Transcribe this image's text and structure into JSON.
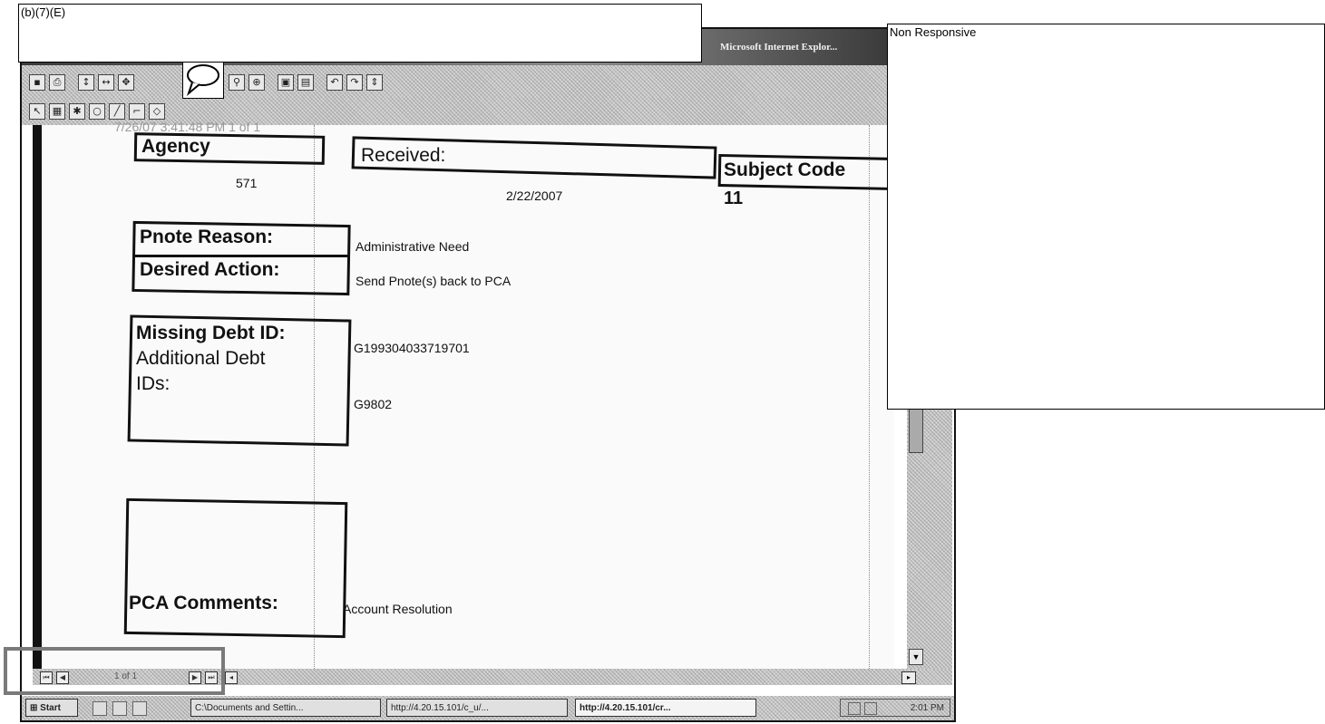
{
  "redactions": {
    "top_left": "(b)(7)(E)",
    "top_right": "Non Responsive"
  },
  "browser": {
    "title": "Microsoft Internet Explor..."
  },
  "document": {
    "faint_header": "7/26/07 3:41:48 PM  1 of 1",
    "agency_label": "Agency",
    "agency_value": "571",
    "received_label": "Received:",
    "received_value": "2/22/2007",
    "subject_code_label": "Subject Code",
    "subject_code_value": "11",
    "pnote_reason_label": "Pnote Reason:",
    "pnote_reason_value": "Administrative Need",
    "desired_action_label": "Desired Action:",
    "desired_action_value": "Send Pnote(s) back to PCA",
    "missing_debt_label": "Missing Debt ID:",
    "missing_debt_value": "G199304033719701",
    "additional_debt_label_1": "Additional Debt",
    "additional_debt_label_2": "IDs:",
    "additional_debt_value": "G9802",
    "pca_comments_label": "PCA Comments:",
    "pca_comments_value": "Account Resolution"
  },
  "viewer": {
    "page_indicator": "1 of 1"
  },
  "taskbar": {
    "start_label": "Start",
    "items": [
      "C:\\Documents and Settin...",
      "http://4.20.15.101/c_u/...",
      "http://4.20.15.101/cr..."
    ],
    "clock": "2:01 PM"
  }
}
